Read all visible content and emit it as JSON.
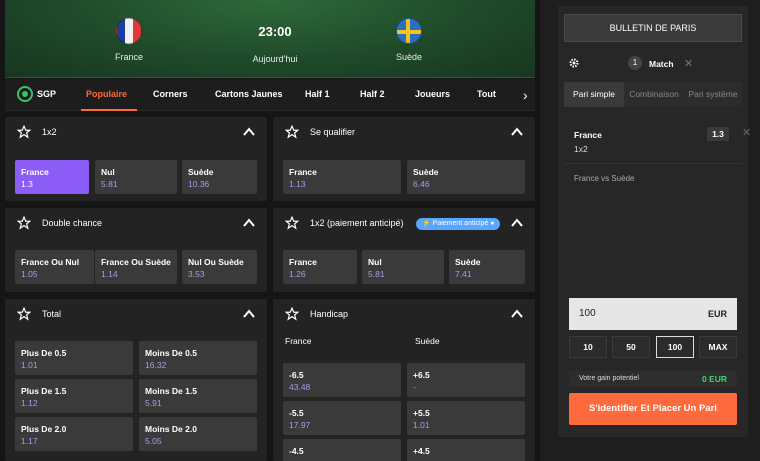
{
  "header": {
    "home_team": "France",
    "away_team": "Suède",
    "time": "23:00",
    "date": "Aujourd'hui"
  },
  "tabs": [
    "SGP",
    "Populaire",
    "Corners",
    "Cartons Jaunes",
    "Half 1",
    "Half 2",
    "Joueurs",
    "Tout"
  ],
  "markets": {
    "x12": {
      "title": "1x2",
      "odds": [
        {
          "label": "France",
          "value": "1.3"
        },
        {
          "label": "Nul",
          "value": "5.81"
        },
        {
          "label": "Suède",
          "value": "10.36"
        }
      ]
    },
    "qualify": {
      "title": "Se qualifier",
      "odds": [
        {
          "label": "France",
          "value": "1.13"
        },
        {
          "label": "Suède",
          "value": "6.46"
        }
      ]
    },
    "double": {
      "title": "Double chance",
      "odds": [
        {
          "label": "France Ou Nul",
          "value": "1.05"
        },
        {
          "label": "France Ou Suède",
          "value": "1.14"
        },
        {
          "label": "Nul Ou Suède",
          "value": "3.53"
        }
      ]
    },
    "early": {
      "title": "1x2 (paiement anticipé)",
      "badge": "⚡ Paiement anticipé ●",
      "odds": [
        {
          "label": "France",
          "value": "1.26"
        },
        {
          "label": "Nul",
          "value": "5.81"
        },
        {
          "label": "Suède",
          "value": "7.41"
        }
      ]
    },
    "total": {
      "title": "Total",
      "odds": [
        {
          "label": "Plus De 0.5",
          "value": "1.01"
        },
        {
          "label": "Moins De 0.5",
          "value": "16.32"
        },
        {
          "label": "Plus De 1.5",
          "value": "1.12"
        },
        {
          "label": "Moins De 1.5",
          "value": "5.91"
        },
        {
          "label": "Plus De 2.0",
          "value": "1.17"
        },
        {
          "label": "Moins De 2.0",
          "value": "5.05"
        }
      ]
    },
    "handicap": {
      "title": "Handicap",
      "col_home": "France",
      "col_away": "Suède",
      "odds": [
        {
          "label": "-6.5",
          "value": "43.48"
        },
        {
          "label": "+6.5",
          "value": "-"
        },
        {
          "label": "-5.5",
          "value": "17.97"
        },
        {
          "label": "+5.5",
          "value": "1.01"
        },
        {
          "label": "-4.5",
          "value": ""
        },
        {
          "label": "+4.5",
          "value": ""
        }
      ]
    }
  },
  "betslip": {
    "title": "BULLETIN DE PARIS",
    "count": "1",
    "count_label": "Match",
    "types": [
      "Pari simple",
      "Combinaison",
      "Pari système"
    ],
    "selection": {
      "team": "France",
      "market": "1x2",
      "odd": "1.3",
      "event": "France vs Suède"
    },
    "stake": "100",
    "currency": "EUR",
    "quick": [
      "10",
      "50",
      "100",
      "MAX"
    ],
    "gain_label": "Votre gain potentiel",
    "gain_value": "0 EUR",
    "cta": "S'identifier Et Placer Un Pari"
  },
  "colors": {
    "accent": "#ff6a3d",
    "selected": "#8b5cf6",
    "odd_value": "#a89be8",
    "gain": "#3fd56f"
  }
}
